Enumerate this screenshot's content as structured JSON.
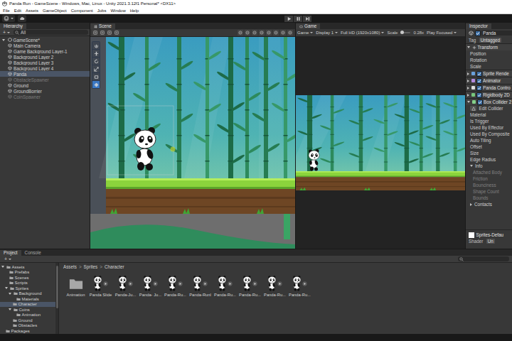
{
  "window": {
    "title": "Panda Run - GameScene - Windows, Mac, Linux - Unity 2021.3.12f1 Personal* <DX11>"
  },
  "menu": [
    "File",
    "Edit",
    "Assets",
    "GameObject",
    "Component",
    "Jobs",
    "Window",
    "Help"
  ],
  "play_mode": {
    "playing": false,
    "paused": false
  },
  "hierarchy": {
    "tab": "Hierarchy",
    "add": "+",
    "filter": "All",
    "root": {
      "label": "GameScene*",
      "selected": false,
      "disabled": false,
      "expanded": true,
      "children": [
        {
          "label": "Main Camera",
          "selected": false,
          "disabled": false
        },
        {
          "label": "Game Background Layer-1",
          "selected": false,
          "disabled": false
        },
        {
          "label": "Background Layer 2",
          "selected": false,
          "disabled": false
        },
        {
          "label": "Background Layer 3",
          "selected": false,
          "disabled": false
        },
        {
          "label": "Background Layer 4",
          "selected": false,
          "disabled": false
        },
        {
          "label": "Panda",
          "selected": true,
          "disabled": false
        },
        {
          "label": "ObstacleSpawner",
          "selected": false,
          "disabled": true
        },
        {
          "label": "Ground",
          "selected": false,
          "disabled": false
        },
        {
          "label": "GroundBorrier",
          "selected": false,
          "disabled": false
        },
        {
          "label": "CoinSpawner",
          "selected": false,
          "disabled": true
        }
      ]
    }
  },
  "scene_view": {
    "tab": "Scene",
    "selected": true,
    "tools": [
      {
        "selected": false
      },
      {
        "selected": false
      },
      {
        "selected": false
      },
      {
        "selected": false
      },
      {
        "selected": false
      },
      {
        "selected": true
      }
    ]
  },
  "game_view": {
    "tab": "Game",
    "selected": true,
    "mode": "Game",
    "display": "Display 1",
    "resolution": "Full HD (1920x1080)",
    "scale_label": "Scale",
    "scale_level": 0.1,
    "scale": "0.28x",
    "play_focus": "Play Focused"
  },
  "inspector": {
    "tab": "Inspector",
    "object": {
      "name": "Panda",
      "active": true
    },
    "tag_label": "Tag",
    "tag": "Untagged",
    "transform": {
      "title": "Transform",
      "expanded": true,
      "fields": [
        "Position",
        "Rotation",
        "Scale"
      ]
    },
    "components": [
      {
        "name": "Sprite Rende",
        "enabled": true,
        "expanded": false
      },
      {
        "name": "Animator",
        "enabled": true,
        "expanded": false
      },
      {
        "name": "Panda Contro",
        "enabled": true,
        "expanded": false
      },
      {
        "name": "Rigidbody 2D",
        "enabled": true,
        "expanded": false
      },
      {
        "name": "Box Collider 2",
        "enabled": true,
        "expanded": true
      }
    ],
    "collider": {
      "edit": "Edit Collider",
      "fields": [
        "Material",
        "Is Trigger",
        "Used By Effector",
        "Used By Composite",
        "Auto Tiling",
        "Offset",
        "Size",
        "Edge Radius"
      ]
    },
    "info": {
      "title": "Info",
      "expanded": true,
      "fields": [
        {
          "label": "Attached Body",
          "disabled": true
        },
        {
          "label": "Friction",
          "disabled": true
        },
        {
          "label": "Bounciness",
          "disabled": true
        },
        {
          "label": "Shape Count",
          "disabled": true
        },
        {
          "label": "Bounds",
          "disabled": true
        }
      ]
    },
    "contacts": {
      "title": "Contacts",
      "expanded": false
    },
    "material": {
      "name": "Sprites-Defau",
      "shader_label": "Shader",
      "shader": "Un"
    }
  },
  "project": {
    "tabs": [
      {
        "label": "Project",
        "selected": true
      },
      {
        "label": "Console",
        "selected": false
      }
    ],
    "add": "+",
    "tree": [
      {
        "label": "Assets",
        "selected": false,
        "expanded": true,
        "children": [
          {
            "label": "Prefabs",
            "selected": false
          },
          {
            "label": "Scenes",
            "selected": false
          },
          {
            "label": "Scripts",
            "selected": false
          },
          {
            "label": "Sprites",
            "selected": false,
            "expanded": true,
            "children": [
              {
                "label": "Background",
                "selected": false,
                "expanded": true,
                "children": [
                  {
                    "label": "Materials",
                    "selected": false
                  }
                ]
              },
              {
                "label": "Character",
                "selected": true
              },
              {
                "label": "Coins",
                "selected": false,
                "expanded": true,
                "children": [
                  {
                    "label": "Animation",
                    "selected": false
                  }
                ]
              },
              {
                "label": "Ground",
                "selected": false
              },
              {
                "label": "Obstacles",
                "selected": false
              }
            ]
          }
        ]
      },
      {
        "label": "Packages",
        "selected": false
      }
    ],
    "breadcrumb": [
      "Assets",
      "Sprites",
      "Character"
    ],
    "separator": ">",
    "assets": [
      {
        "label": "Animation",
        "kind": "folder"
      },
      {
        "label": "Panda Slide",
        "kind": "sprite"
      },
      {
        "label": "Panda-Ju...",
        "kind": "sprite"
      },
      {
        "label": "Panda- Ju...",
        "kind": "sprite"
      },
      {
        "label": "Panda-Ru...",
        "kind": "sprite"
      },
      {
        "label": "Panda-Runl",
        "kind": "sprite"
      },
      {
        "label": "Panda-Ru...",
        "kind": "sprite"
      },
      {
        "label": "Panda-Ru...",
        "kind": "sprite"
      },
      {
        "label": "Panda-Ru...",
        "kind": "sprite"
      },
      {
        "label": "Panda-Ru...",
        "kind": "sprite"
      }
    ]
  }
}
